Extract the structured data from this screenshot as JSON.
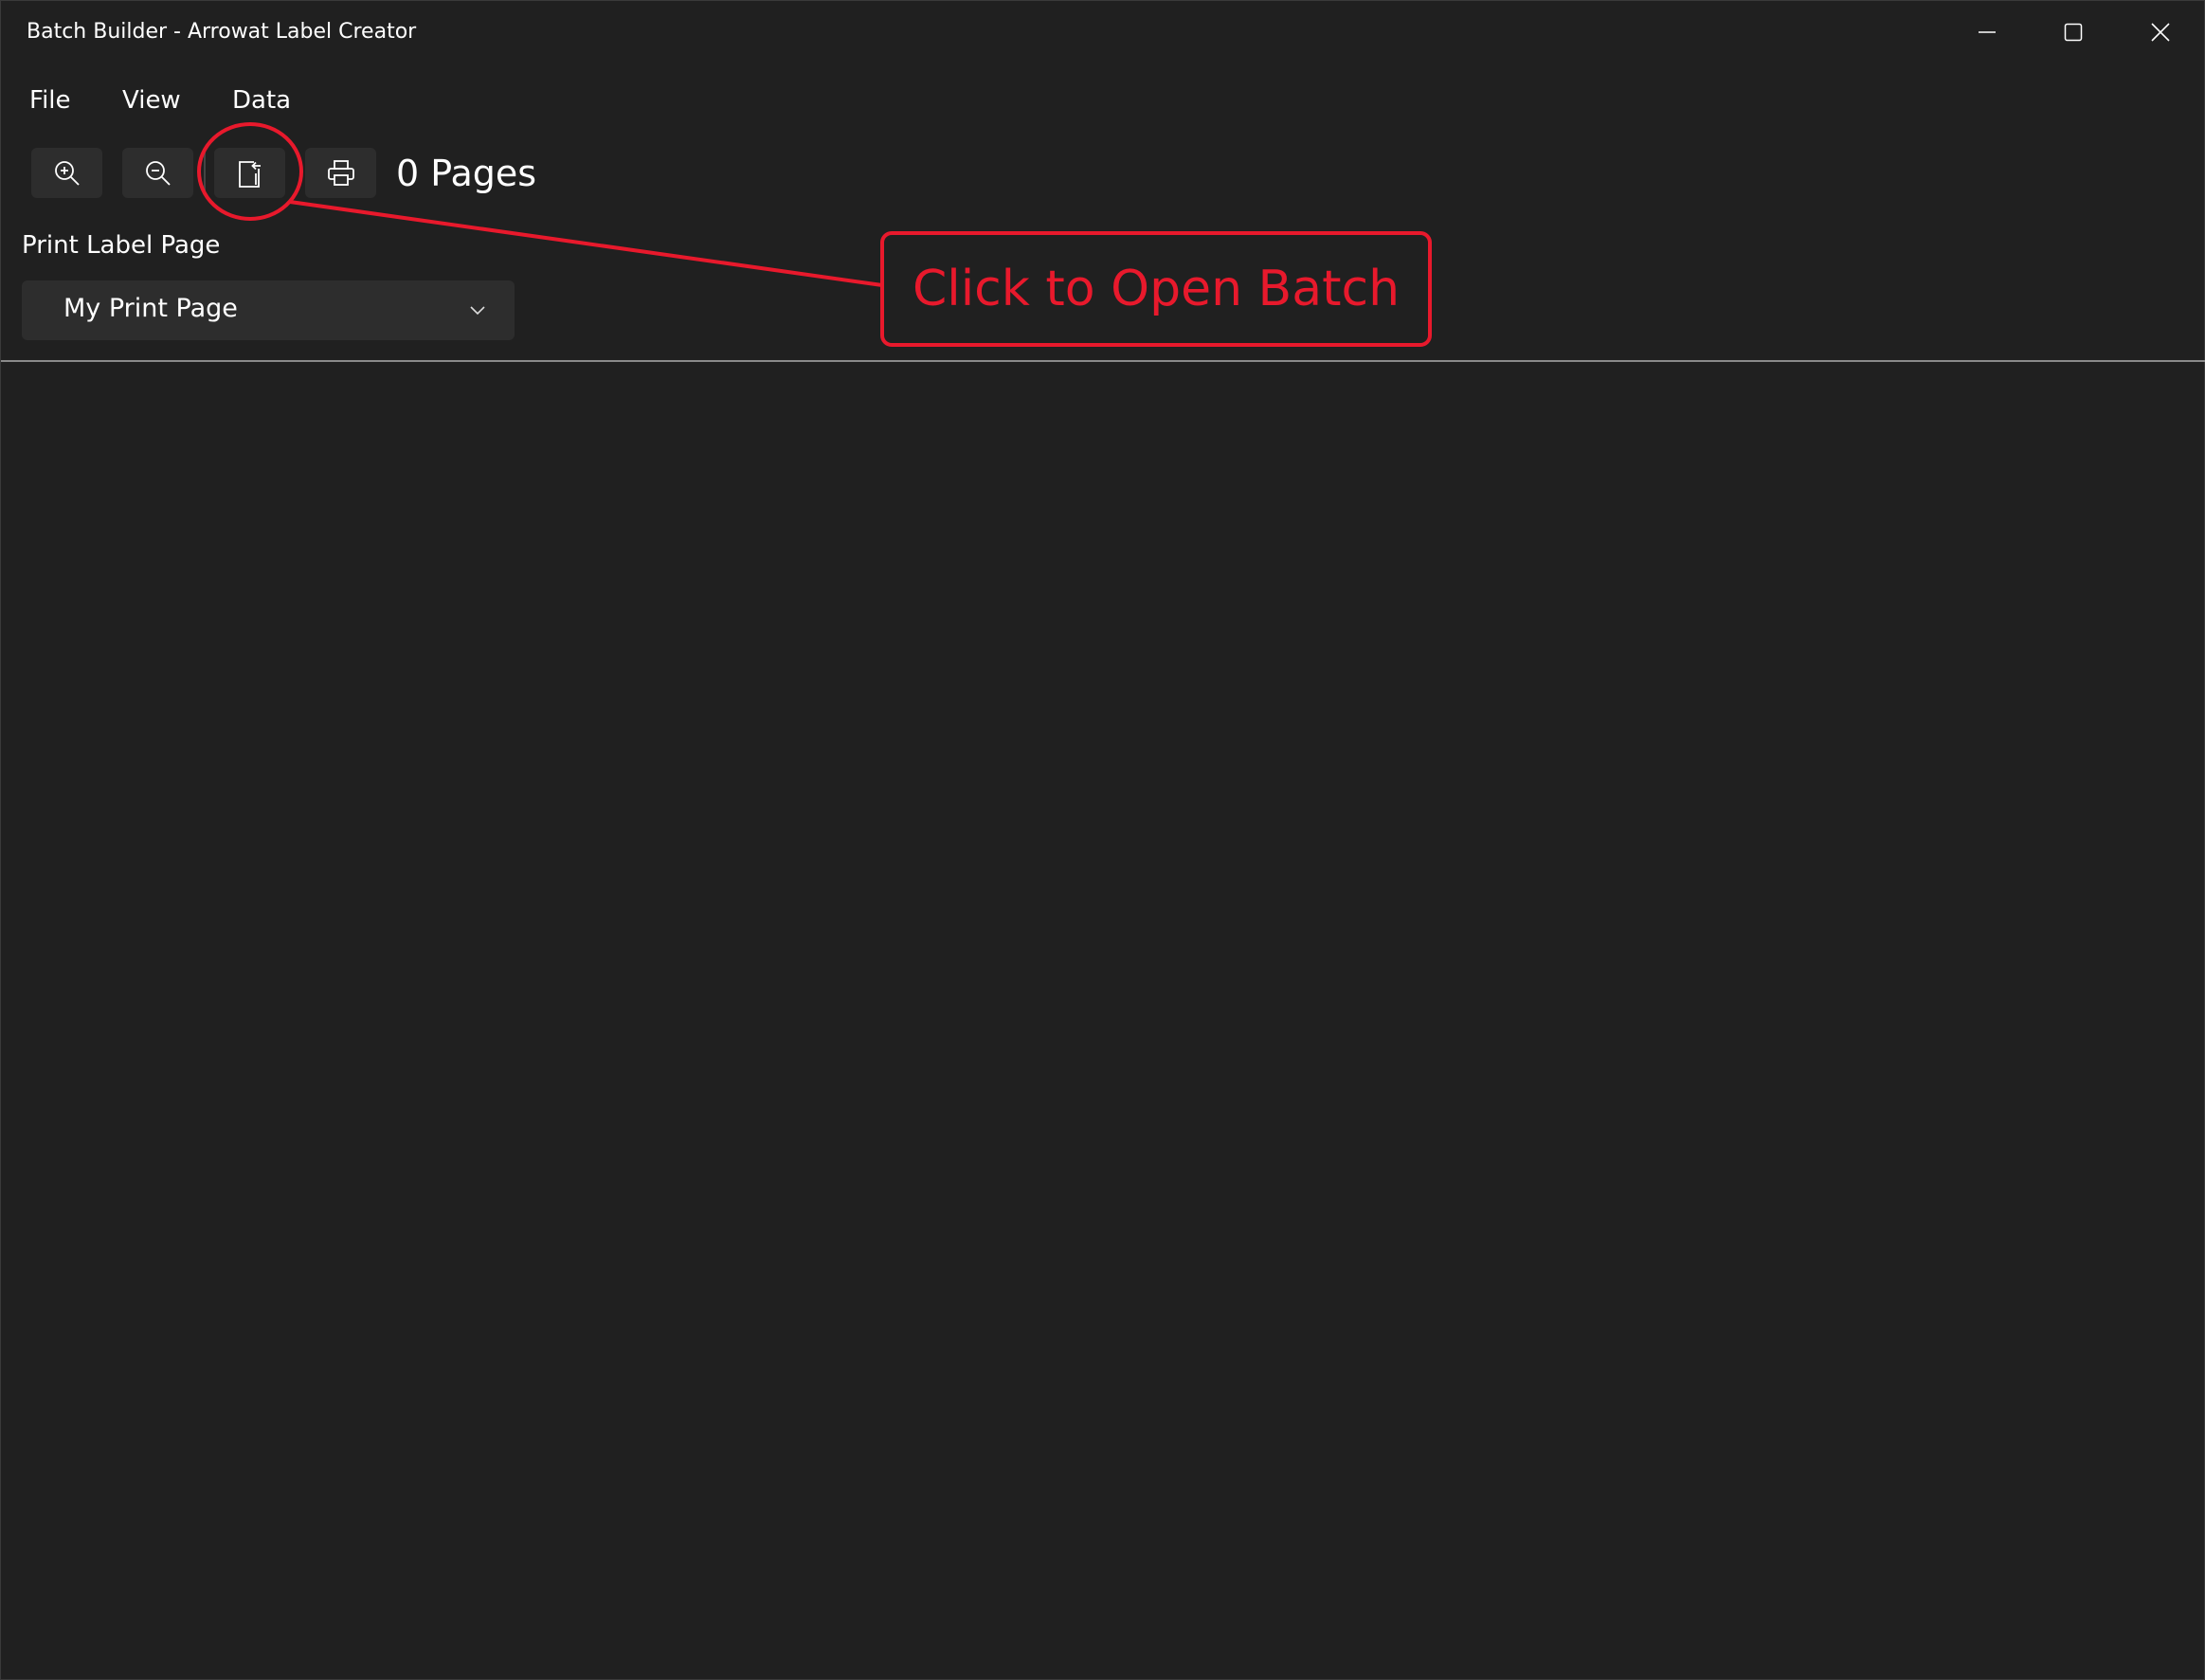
{
  "window": {
    "title": "Batch Builder - Arrowat Label Creator"
  },
  "menu": [
    {
      "label": "File"
    },
    {
      "label": "View"
    },
    {
      "label": "Data"
    }
  ],
  "toolbar": {
    "buttons": [
      {
        "icon": "zoom-in-icon"
      },
      {
        "icon": "zoom-out-icon"
      },
      {
        "icon": "open-batch-icon"
      },
      {
        "icon": "printer-icon"
      }
    ],
    "page_count": "0 Pages"
  },
  "print_page": {
    "label": "Print Label Page",
    "selected": "My Print Page"
  },
  "annotation": {
    "text": "Click to Open Batch",
    "color": "#e8192c"
  }
}
